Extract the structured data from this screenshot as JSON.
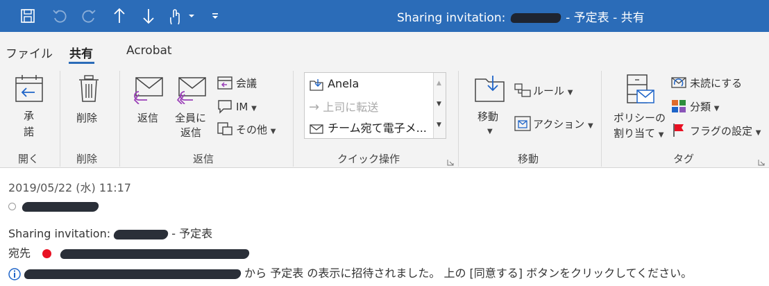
{
  "window": {
    "title_prefix": "Sharing invitation: ",
    "title_suffix": " - 予定表  -  共有"
  },
  "menu": {
    "tabs": [
      {
        "label": "ファイル"
      },
      {
        "label": "共有"
      },
      {
        "label": "Acrobat"
      }
    ]
  },
  "ribbon": {
    "open": {
      "accept_line1": "承",
      "accept_line2": "諾",
      "group": "開く"
    },
    "delete": {
      "label": "削除",
      "group": "削除"
    },
    "respond": {
      "reply": "返信",
      "reply_all_line1": "全員に",
      "reply_all_line2": "返信",
      "meeting": "会議",
      "im": "IM",
      "more": "その他",
      "group": "返信"
    },
    "quick_steps": {
      "items": [
        "Anela",
        "上司に転送",
        "チーム宛て電子メ..."
      ],
      "group": "クイック操作"
    },
    "move": {
      "move": "移動",
      "rules": "ルール",
      "actions": "アクション",
      "group": "移動"
    },
    "tags": {
      "policy_line1": "ポリシーの",
      "policy_line2": "割り当て",
      "unread": "未読にする",
      "categorize": "分類",
      "flag": "フラグの設定",
      "group": "タグ"
    }
  },
  "message": {
    "date": "2019/05/22 (水) 11:17",
    "subject_prefix": "Sharing invitation: ",
    "subject_suffix": " - 予定表",
    "to_label": "宛先",
    "info_mid": " から ",
    "info_text": "予定表 の表示に招待されました。 上の [同意する] ボタンをクリックしてください。",
    "colors": {
      "presence_busy": "#e81123",
      "info_icon": "#1e64c8"
    }
  }
}
